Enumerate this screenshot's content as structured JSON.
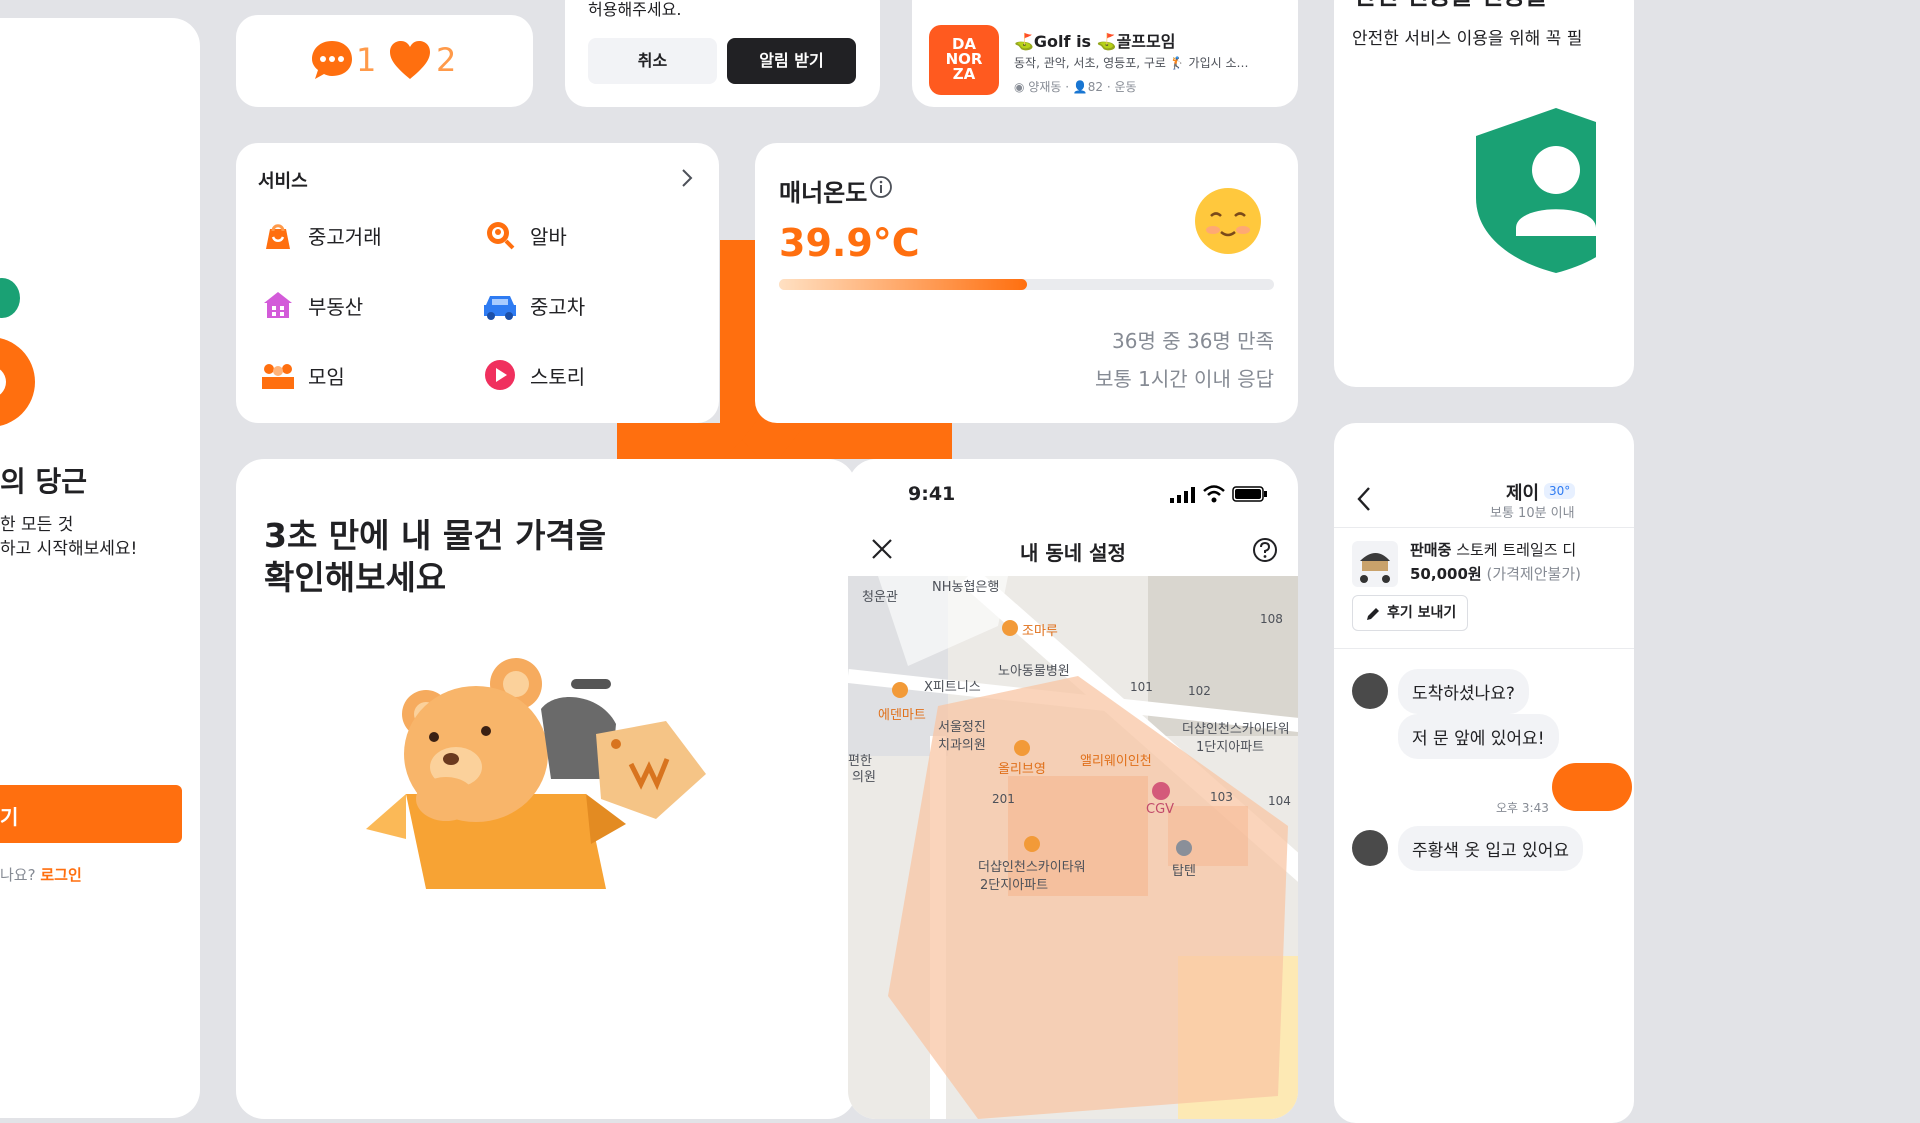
{
  "theme": {
    "accent": "#ff6f0f",
    "dark": "#212124",
    "bg": "#e2e3e7",
    "shield": "#1aa174"
  },
  "login_card": {
    "title_fragment": "의 당근",
    "desc_line1": "한 모든 것",
    "desc_line2": "하고 시작해보세요!",
    "start_button_fragment": "기",
    "question": "나요?",
    "login_link": "로그인"
  },
  "counts_card": {
    "chat_count": "1",
    "like_count": "2"
  },
  "permission_card": {
    "text": "허용해주세요.",
    "cancel_label": "취소",
    "confirm_label": "알림 받기"
  },
  "group_card": {
    "logo_lines": [
      "DA",
      "NOR",
      "ZA"
    ],
    "title": "⛳Golf is ⛳골프모임",
    "subtitle": "동작, 관악, 서초, 영등포, 구로 🏌 가입시 소…",
    "meta": "◉ 양재동 · 👤82 · 운동"
  },
  "safety_card": {
    "title_fragment": "안전 인증을 인증을",
    "subtitle": "안전한 서비스 이용을 위해 꼭 필"
  },
  "services_card": {
    "title": "서비스",
    "items": [
      {
        "label": "중고거래",
        "icon": "shopping-bag-icon"
      },
      {
        "label": "알바",
        "icon": "search-job-icon"
      },
      {
        "label": "부동산",
        "icon": "house-icon"
      },
      {
        "label": "중고차",
        "icon": "car-icon"
      },
      {
        "label": "모임",
        "icon": "group-icon"
      },
      {
        "label": "스토리",
        "icon": "play-icon"
      }
    ]
  },
  "manner_card": {
    "title": "매너온도",
    "temperature": "39.9°C",
    "progress": 0.5,
    "line1": "36명 중 36명 만족",
    "line2": "보통 1시간 이내 응답"
  },
  "price_card": {
    "line1": "3초 만에 내 물건 가격을",
    "line2": "확인해보세요"
  },
  "map_card": {
    "time": "9:41",
    "title": "내 동네 설정",
    "labels": {
      "l1": "청운관",
      "l2": "NH농협은행",
      "l3": "조마루",
      "l4": "노아동물병원",
      "l5": "108",
      "l6": "X피트니스",
      "l7": "에덴마트",
      "l8": "서울정진",
      "l9": "치과의원",
      "l10": "101",
      "l11": "102",
      "l12": "더샵인천스카이타워",
      "l13": "1단지아파트",
      "l14": "올리브영",
      "l15": "앨리웨이인천",
      "l16": "편한",
      "l17": "의원",
      "l18": "CGV",
      "l19": "201",
      "l20": "103",
      "l21": "104",
      "l22": "더샵인천스카이타워",
      "l23": "2단지아파트",
      "l24": "탑텐"
    }
  },
  "chat_card": {
    "name": "제이",
    "temp_badge": "30°",
    "response": "보통 10분 이내",
    "product_status": "판매중",
    "product_name": "스토케 트레일즈 디",
    "price": "50,000원",
    "price_note": "(가격제안불가)",
    "review_button": "후기 보내기",
    "msg1": "도착하셨나요?",
    "msg2": "저 문 앞에 있어요!",
    "time": "오후 3:43",
    "msg3": "주황색 옷 입고 있어요"
  }
}
